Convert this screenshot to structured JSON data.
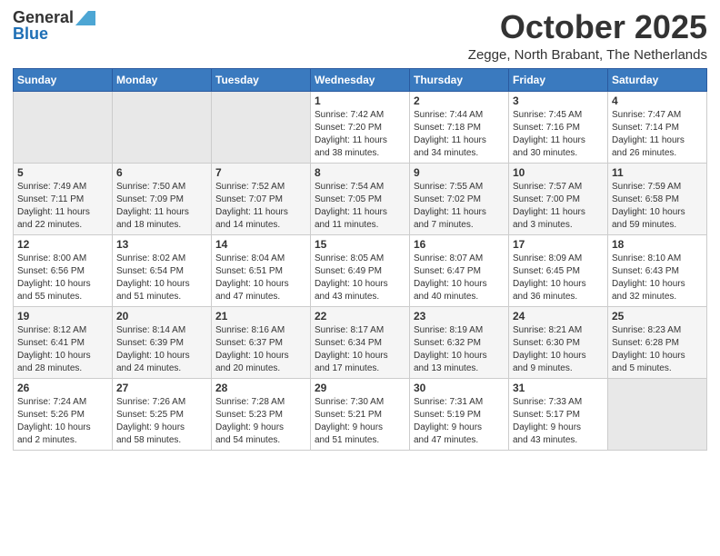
{
  "logo": {
    "general": "General",
    "blue": "Blue"
  },
  "title": {
    "month": "October 2025",
    "location": "Zegge, North Brabant, The Netherlands"
  },
  "headers": [
    "Sunday",
    "Monday",
    "Tuesday",
    "Wednesday",
    "Thursday",
    "Friday",
    "Saturday"
  ],
  "weeks": [
    [
      {
        "day": "",
        "info": "",
        "empty": true
      },
      {
        "day": "",
        "info": "",
        "empty": true
      },
      {
        "day": "",
        "info": "",
        "empty": true
      },
      {
        "day": "1",
        "info": "Sunrise: 7:42 AM\nSunset: 7:20 PM\nDaylight: 11 hours\nand 38 minutes."
      },
      {
        "day": "2",
        "info": "Sunrise: 7:44 AM\nSunset: 7:18 PM\nDaylight: 11 hours\nand 34 minutes."
      },
      {
        "day": "3",
        "info": "Sunrise: 7:45 AM\nSunset: 7:16 PM\nDaylight: 11 hours\nand 30 minutes."
      },
      {
        "day": "4",
        "info": "Sunrise: 7:47 AM\nSunset: 7:14 PM\nDaylight: 11 hours\nand 26 minutes."
      }
    ],
    [
      {
        "day": "5",
        "info": "Sunrise: 7:49 AM\nSunset: 7:11 PM\nDaylight: 11 hours\nand 22 minutes."
      },
      {
        "day": "6",
        "info": "Sunrise: 7:50 AM\nSunset: 7:09 PM\nDaylight: 11 hours\nand 18 minutes."
      },
      {
        "day": "7",
        "info": "Sunrise: 7:52 AM\nSunset: 7:07 PM\nDaylight: 11 hours\nand 14 minutes."
      },
      {
        "day": "8",
        "info": "Sunrise: 7:54 AM\nSunset: 7:05 PM\nDaylight: 11 hours\nand 11 minutes."
      },
      {
        "day": "9",
        "info": "Sunrise: 7:55 AM\nSunset: 7:02 PM\nDaylight: 11 hours\nand 7 minutes."
      },
      {
        "day": "10",
        "info": "Sunrise: 7:57 AM\nSunset: 7:00 PM\nDaylight: 11 hours\nand 3 minutes."
      },
      {
        "day": "11",
        "info": "Sunrise: 7:59 AM\nSunset: 6:58 PM\nDaylight: 10 hours\nand 59 minutes."
      }
    ],
    [
      {
        "day": "12",
        "info": "Sunrise: 8:00 AM\nSunset: 6:56 PM\nDaylight: 10 hours\nand 55 minutes."
      },
      {
        "day": "13",
        "info": "Sunrise: 8:02 AM\nSunset: 6:54 PM\nDaylight: 10 hours\nand 51 minutes."
      },
      {
        "day": "14",
        "info": "Sunrise: 8:04 AM\nSunset: 6:51 PM\nDaylight: 10 hours\nand 47 minutes."
      },
      {
        "day": "15",
        "info": "Sunrise: 8:05 AM\nSunset: 6:49 PM\nDaylight: 10 hours\nand 43 minutes."
      },
      {
        "day": "16",
        "info": "Sunrise: 8:07 AM\nSunset: 6:47 PM\nDaylight: 10 hours\nand 40 minutes."
      },
      {
        "day": "17",
        "info": "Sunrise: 8:09 AM\nSunset: 6:45 PM\nDaylight: 10 hours\nand 36 minutes."
      },
      {
        "day": "18",
        "info": "Sunrise: 8:10 AM\nSunset: 6:43 PM\nDaylight: 10 hours\nand 32 minutes."
      }
    ],
    [
      {
        "day": "19",
        "info": "Sunrise: 8:12 AM\nSunset: 6:41 PM\nDaylight: 10 hours\nand 28 minutes."
      },
      {
        "day": "20",
        "info": "Sunrise: 8:14 AM\nSunset: 6:39 PM\nDaylight: 10 hours\nand 24 minutes."
      },
      {
        "day": "21",
        "info": "Sunrise: 8:16 AM\nSunset: 6:37 PM\nDaylight: 10 hours\nand 20 minutes."
      },
      {
        "day": "22",
        "info": "Sunrise: 8:17 AM\nSunset: 6:34 PM\nDaylight: 10 hours\nand 17 minutes."
      },
      {
        "day": "23",
        "info": "Sunrise: 8:19 AM\nSunset: 6:32 PM\nDaylight: 10 hours\nand 13 minutes."
      },
      {
        "day": "24",
        "info": "Sunrise: 8:21 AM\nSunset: 6:30 PM\nDaylight: 10 hours\nand 9 minutes."
      },
      {
        "day": "25",
        "info": "Sunrise: 8:23 AM\nSunset: 6:28 PM\nDaylight: 10 hours\nand 5 minutes."
      }
    ],
    [
      {
        "day": "26",
        "info": "Sunrise: 7:24 AM\nSunset: 5:26 PM\nDaylight: 10 hours\nand 2 minutes."
      },
      {
        "day": "27",
        "info": "Sunrise: 7:26 AM\nSunset: 5:25 PM\nDaylight: 9 hours\nand 58 minutes."
      },
      {
        "day": "28",
        "info": "Sunrise: 7:28 AM\nSunset: 5:23 PM\nDaylight: 9 hours\nand 54 minutes."
      },
      {
        "day": "29",
        "info": "Sunrise: 7:30 AM\nSunset: 5:21 PM\nDaylight: 9 hours\nand 51 minutes."
      },
      {
        "day": "30",
        "info": "Sunrise: 7:31 AM\nSunset: 5:19 PM\nDaylight: 9 hours\nand 47 minutes."
      },
      {
        "day": "31",
        "info": "Sunrise: 7:33 AM\nSunset: 5:17 PM\nDaylight: 9 hours\nand 43 minutes."
      },
      {
        "day": "",
        "info": "",
        "empty": true
      }
    ]
  ]
}
